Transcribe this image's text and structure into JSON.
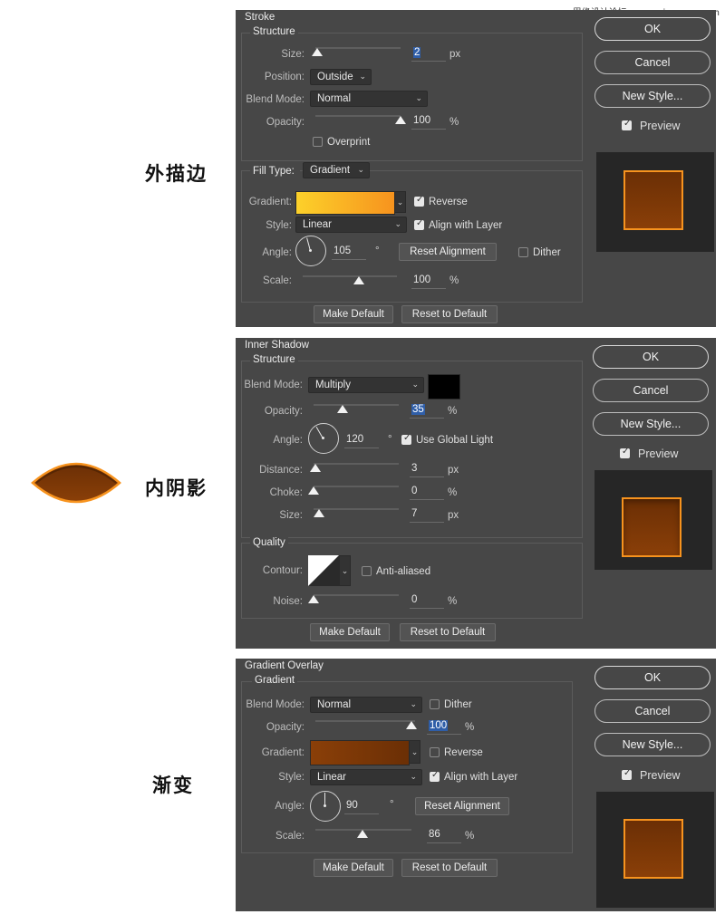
{
  "watermark": "思缘设计论坛 www.missyuan.com",
  "captions": {
    "stroke": "外描边",
    "inner_shadow": "内阴影",
    "gradient": "渐变"
  },
  "side_buttons": {
    "ok": "OK",
    "cancel": "Cancel",
    "new_style": "New Style...",
    "preview": "Preview"
  },
  "colors": {
    "dialog_bg": "#474747",
    "orange": "#f7931e",
    "yellow": "#fcd12a",
    "brown_dark": "#6b2f05",
    "brown_mid": "#8a3f08",
    "selection": "#2f5ea8"
  },
  "stroke": {
    "title": "Stroke",
    "structure_label": "Structure",
    "size_label": "Size:",
    "size_value": "2",
    "size_unit": "px",
    "size_level": 0.02,
    "position_label": "Position:",
    "position_value": "Outside",
    "blend_label": "Blend Mode:",
    "blend_value": "Normal",
    "opacity_label": "Opacity:",
    "opacity_value": "100",
    "opacity_unit": "%",
    "overprint_label": "Overprint",
    "overprint_checked": false,
    "fill_type_label": "Fill Type:",
    "fill_type_value": "Gradient",
    "gradient_label": "Gradient:",
    "reverse_label": "Reverse",
    "reverse_checked": true,
    "style_label": "Style:",
    "style_value": "Linear",
    "align_label": "Align with Layer",
    "align_checked": true,
    "angle_label": "Angle:",
    "angle_value": "105",
    "angle_unit": "°",
    "reset_alignment": "Reset Alignment",
    "dither_label": "Dither",
    "dither_checked": false,
    "scale_label": "Scale:",
    "scale_value": "100",
    "scale_unit": "%",
    "make_default": "Make Default",
    "reset_default": "Reset to Default"
  },
  "inner_shadow": {
    "title": "Inner Shadow",
    "structure_label": "Structure",
    "blend_label": "Blend Mode:",
    "blend_value": "Multiply",
    "shadow_color": "#000000",
    "opacity_label": "Opacity:",
    "opacity_value": "35",
    "opacity_unit": "%",
    "angle_label": "Angle:",
    "angle_value": "120",
    "angle_unit": "°",
    "global_light_label": "Use Global Light",
    "global_light_checked": true,
    "distance_label": "Distance:",
    "distance_value": "3",
    "distance_unit": "px",
    "choke_label": "Choke:",
    "choke_value": "0",
    "choke_unit": "%",
    "size_label": "Size:",
    "size_value": "7",
    "size_unit": "px",
    "quality_label": "Quality",
    "contour_label": "Contour:",
    "anti_aliased_label": "Anti-aliased",
    "anti_aliased_checked": false,
    "noise_label": "Noise:",
    "noise_value": "0",
    "noise_unit": "%",
    "make_default": "Make Default",
    "reset_default": "Reset to Default"
  },
  "gradient_overlay": {
    "title": "Gradient Overlay",
    "gradient_group_label": "Gradient",
    "blend_label": "Blend Mode:",
    "blend_value": "Normal",
    "dither_label": "Dither",
    "dither_checked": false,
    "opacity_label": "Opacity:",
    "opacity_value": "100",
    "opacity_unit": "%",
    "gradient_label": "Gradient:",
    "reverse_label": "Reverse",
    "reverse_checked": false,
    "style_label": "Style:",
    "style_value": "Linear",
    "align_label": "Align with Layer",
    "align_checked": true,
    "angle_label": "Angle:",
    "angle_value": "90",
    "angle_unit": "°",
    "reset_alignment": "Reset Alignment",
    "scale_label": "Scale:",
    "scale_value": "86",
    "scale_unit": "%",
    "make_default": "Make Default",
    "reset_default": "Reset to Default"
  }
}
